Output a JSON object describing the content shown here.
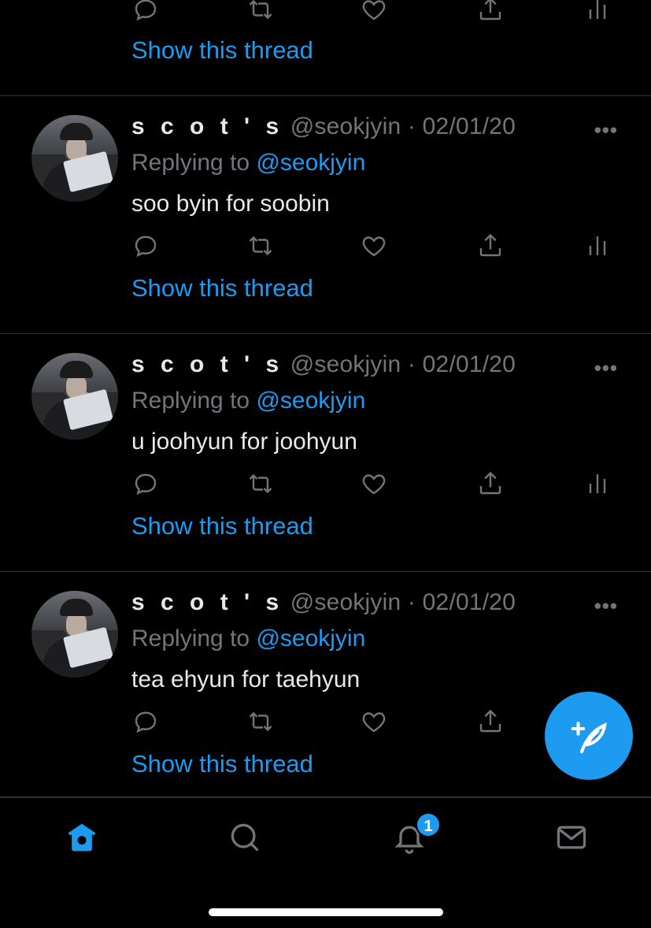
{
  "partial_tweet": {
    "show_thread": "Show this thread"
  },
  "tweets": [
    {
      "name": "s c o t ' s",
      "handle": "@seokjyin",
      "separator": "·",
      "date": "02/01/20",
      "replying_prefix": "Replying to ",
      "replying_to": "@seokjyin",
      "text": "soo byin for soobin",
      "show_thread": "Show this thread"
    },
    {
      "name": "s c o t ' s",
      "handle": "@seokjyin",
      "separator": "·",
      "date": "02/01/20",
      "replying_prefix": "Replying to ",
      "replying_to": "@seokjyin",
      "text": "u joohyun for joohyun",
      "show_thread": "Show this thread"
    },
    {
      "name": "s c o t ' s",
      "handle": "@seokjyin",
      "separator": "·",
      "date": "02/01/20",
      "replying_prefix": "Replying to ",
      "replying_to": "@seokjyin",
      "text": "tea ehyun for taehyun",
      "show_thread": "Show this thread"
    }
  ],
  "more_glyph": "•••",
  "tabbar": {
    "items": [
      "home-icon",
      "search-icon",
      "notifications-icon",
      "messages-icon"
    ],
    "active": "home-icon",
    "notification_count": "1"
  },
  "colors": {
    "accent": "#1d9bf0",
    "background": "#000000",
    "muted": "#71767b",
    "text": "#e7e9ea",
    "divider": "#2f3336"
  }
}
